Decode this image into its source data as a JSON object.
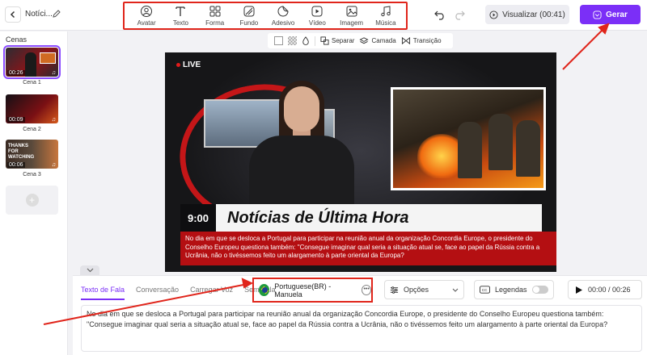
{
  "header": {
    "project_title": "Notíci...",
    "tools": [
      {
        "label": "Avatar",
        "icon": "avatar-icon"
      },
      {
        "label": "Texto",
        "icon": "text-icon"
      },
      {
        "label": "Forma",
        "icon": "shapes-icon"
      },
      {
        "label": "Fundo",
        "icon": "background-icon"
      },
      {
        "label": "Adesivo",
        "icon": "sticker-icon"
      },
      {
        "label": "Vídeo",
        "icon": "video-icon"
      },
      {
        "label": "Imagem",
        "icon": "image-icon"
      },
      {
        "label": "Música",
        "icon": "music-icon"
      }
    ],
    "preview_label": "Visualizar (00:41)",
    "generate_label": "Gerar",
    "accent_color": "#7b2ff7"
  },
  "sidebar": {
    "title": "Cenas",
    "scenes": [
      {
        "label": "Cena 1",
        "duration": "00:26",
        "selected": true
      },
      {
        "label": "Cena 2",
        "duration": "00:09",
        "selected": false
      },
      {
        "label": "Cena 3",
        "duration": "00:06",
        "selected": false,
        "thumb_text": "THANKS FOR WATCHING"
      }
    ],
    "add_symbol": "+"
  },
  "canvas_tools": {
    "separate": "Separar",
    "layer": "Camada",
    "transition": "Transição"
  },
  "video": {
    "live_label": "LIVE",
    "time": "9:00",
    "headline": "Notícias de Última Hora",
    "ticker": "No dia em que se desloca a Portugal para participar na reunião anual da organização Concordia Europe, o presidente do Conselho Europeu questiona também: \"Consegue imaginar qual seria a situação atual se, face ao papel da Rússia contra a Ucrânia, não o tivéssemos feito um alargamento à parte oriental da Europa?"
  },
  "bottom": {
    "tabs": [
      {
        "label": "Texto de Fala",
        "active": true
      },
      {
        "label": "Conversação",
        "active": false
      },
      {
        "label": "Carregar Voz",
        "active": false
      },
      {
        "label": "Sem Fala",
        "active": false
      }
    ],
    "voice": "Portuguese(BR) - Manuela",
    "options_label": "Opções",
    "captions_label": "Legendas",
    "time_display": "00:00 / 00:26",
    "script_text": "No dia em que se desloca a Portugal para participar na reunião anual da organização Concordia Europe, o presidente do Conselho Europeu questiona também: \"Consegue imaginar qual seria a situação atual se, face ao papel da Rússia contra a Ucrânia, não o tivéssemos feito um alargamento à parte oriental da Europa?"
  }
}
